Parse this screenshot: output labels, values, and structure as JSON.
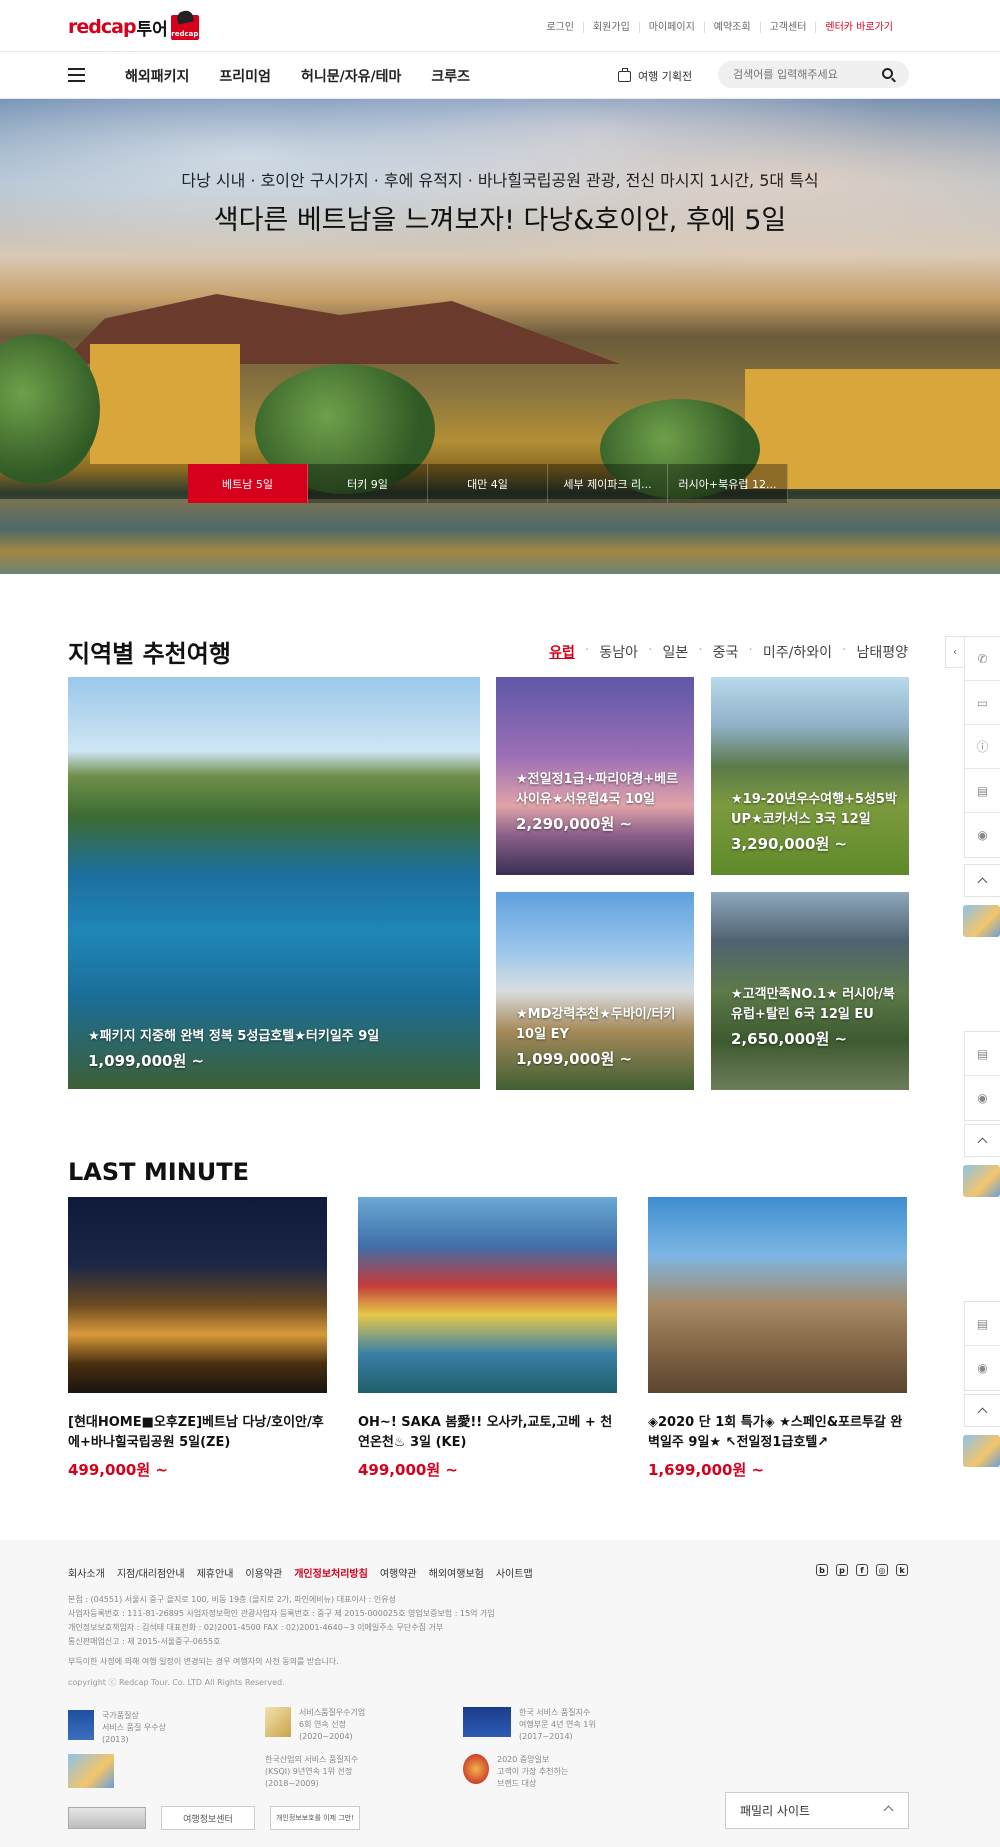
{
  "header": {
    "logo_main": "redcap",
    "logo_sub": "투어",
    "logo_badge": "redcap",
    "util_nav": [
      "로그인",
      "회원가입",
      "마이페이지",
      "예약조회",
      "고객센터",
      "렌터카 바로가기"
    ],
    "gnb": [
      "해외패키지",
      "프리미엄",
      "허니문/자유/테마",
      "크루즈"
    ],
    "plan_label": "여행 기획전",
    "search_placeholder": "검색어를 입력해주세요"
  },
  "hero": {
    "subtitle": "다낭 시내 · 호이안 구시가지 · 후에 유적지 · 바나힐국립공원 관광, 전신 마시지 1시간, 5대 특식",
    "title": "색다른 베트남을 느껴보자! 다낭&호이안, 후에 5일",
    "tabs": [
      "베트남 5일",
      "터키 9일",
      "대만 4일",
      "세부 제이파크 리...",
      "러시아+북유럽 12..."
    ],
    "active_tab": 0
  },
  "regional": {
    "title": "지역별 추천여행",
    "regions": [
      "유럽",
      "동남아",
      "일본",
      "중국",
      "미주/하와이",
      "남태평양"
    ],
    "active_region": 0,
    "cards": [
      {
        "name": "★패키지 지중해 완벽 정복 5성급호텔★터키일주 9일",
        "price": "1,099,000원 ~"
      },
      {
        "name": "★전일정1급+파리야경+베르사이유★서유럽4국 10일",
        "price": "2,290,000원 ~"
      },
      {
        "name": "★19-20년우수여행+5성5박UP★코카서스 3국 12일",
        "price": "3,290,000원 ~"
      },
      {
        "name": "★MD강력추천★두바이/터키 10일 EY",
        "price": "1,099,000원 ~"
      },
      {
        "name": "★고객만족NO.1★ 러시아/북유럽+탈린 6국 12일 EU",
        "price": "2,650,000원 ~"
      }
    ]
  },
  "last_minute": {
    "title": "LAST MINUTE",
    "items": [
      {
        "name": "[현대HOME■오후ZE]베트남 다낭/호이안/후에+바나힐국립공원 5일(ZE)",
        "price": "499,000원 ~"
      },
      {
        "name": "OH~! SAKA 봄愛!! 오사카,교토,고베 + 천연온천♨ 3일 (KE)",
        "price": "499,000원 ~"
      },
      {
        "name": "◈2020 단 1회 특가◈ ★스페인&포르투갈 완벽일주 9일★ ↖전일정1급호텔↗",
        "price": "1,699,000원 ~"
      }
    ]
  },
  "footer": {
    "nav": [
      "회사소개",
      "지점/대리점안내",
      "제휴안내",
      "이용약관",
      "개인정보처리방침",
      "여행약관",
      "해외여행보험",
      "사이트맵"
    ],
    "info_lines": [
      "본점 : (04551) 서울시 중구 을지로 100, 비동 19층 (을지로 2가, 파인에비뉴)    대표이사 : 인유성",
      "사업자등록번호 : 111-81-26895    사업자정보확인    관광사업자 등록번호 : 중구 제 2015-000025호    영업보증보험 : 15억 가입",
      "개인정보보호책임자 : 김석태    대표전화 : 02)2001-4500    FAX : 02)2001-4640~3    이메일주소 무단수집 거부",
      "통신판매업신고 : 제 2015-서울중구-0655호"
    ],
    "warning": "부득이한 사정에 의해 여행 일정이 변경되는 경우 여행자의 사전 동의를 받습니다.",
    "copyright": "copyright ⓒ Redcap Tour. Co. LTD All Rights Reserved.",
    "awards": [
      {
        "lines": [
          "국가품질상",
          "서비스 품질 우수상",
          "(2013)"
        ]
      },
      {
        "lines": [
          "서비스품질우수기업",
          "6회 연속 선정",
          "(2020~2004)"
        ]
      },
      {
        "lines": [
          "한국 서비스 품질지수",
          "여행부문 4년 연속 1위",
          "(2017~2014)"
        ]
      },
      {
        "lines": [
          "한국산업의 서비스 품질지수",
          "(KSQI) 9년연속 1위 선정",
          "(2018~2009)"
        ]
      },
      {
        "lines": [
          "2020 중앙일보",
          "고객이 가장 추천하는",
          "브랜드 대상"
        ]
      }
    ],
    "cert_labels": [
      "여행정보센터",
      "개인정보보호를 이제 그만!"
    ],
    "family_site": "패밀리 사이트"
  },
  "colors": {
    "accent": "#d6001c",
    "footer_bg": "#f7f7f7"
  }
}
